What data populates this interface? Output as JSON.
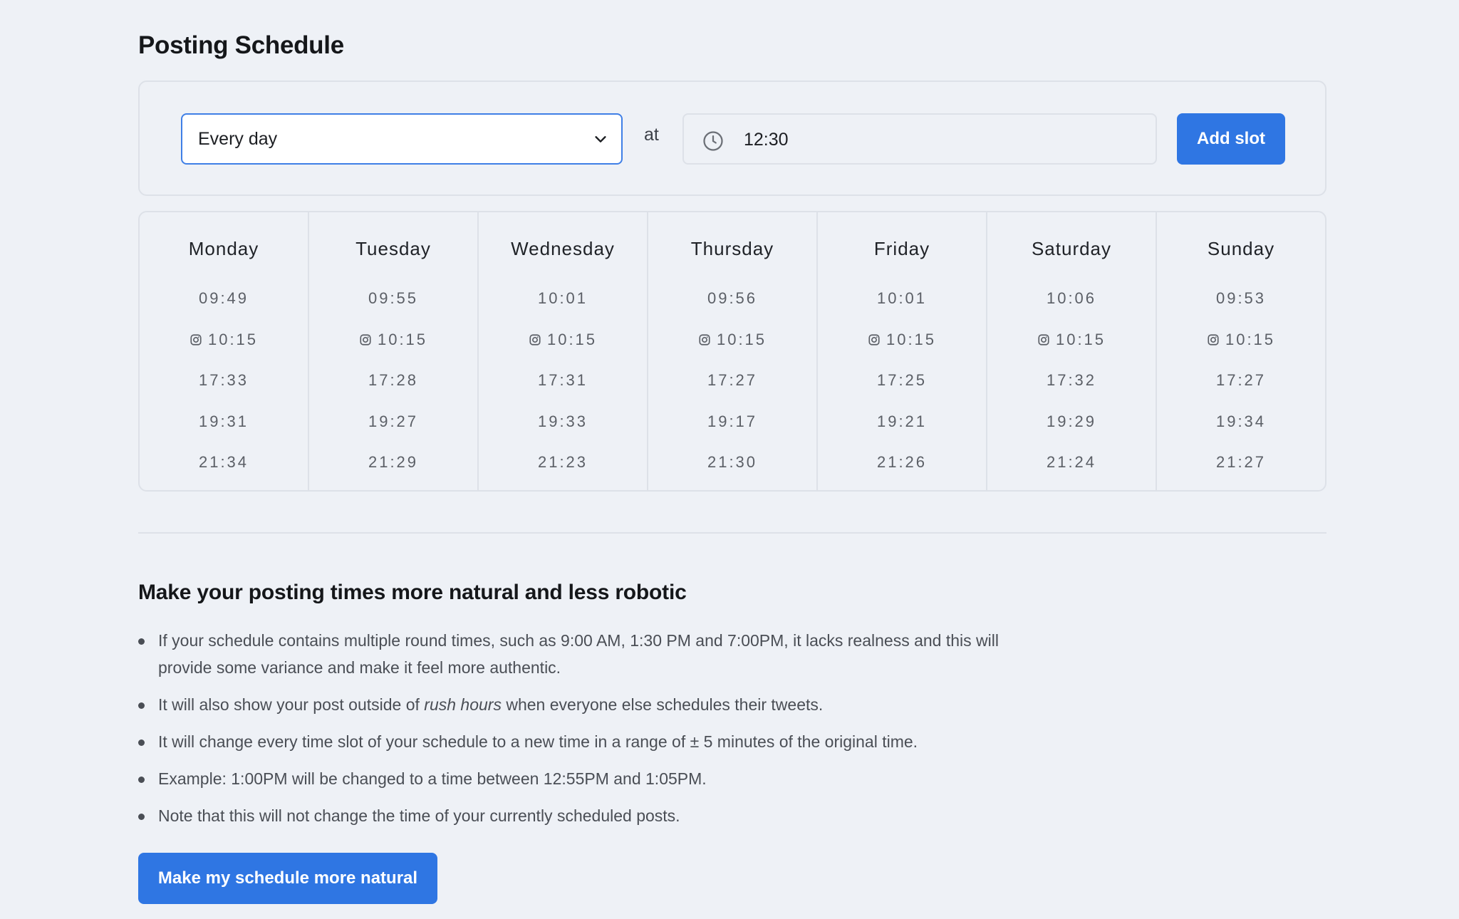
{
  "page": {
    "title": "Posting Schedule"
  },
  "slot_form": {
    "frequency_value": "Every day",
    "at_label": "at",
    "time_value": "12:30",
    "add_button_label": "Add slot"
  },
  "schedule": {
    "days": [
      {
        "name": "Monday",
        "slots": [
          {
            "time": "09:49",
            "icon": false
          },
          {
            "time": "10:15",
            "icon": true
          },
          {
            "time": "17:33",
            "icon": false
          },
          {
            "time": "19:31",
            "icon": false
          },
          {
            "time": "21:34",
            "icon": false
          }
        ]
      },
      {
        "name": "Tuesday",
        "slots": [
          {
            "time": "09:55",
            "icon": false
          },
          {
            "time": "10:15",
            "icon": true
          },
          {
            "time": "17:28",
            "icon": false
          },
          {
            "time": "19:27",
            "icon": false
          },
          {
            "time": "21:29",
            "icon": false
          }
        ]
      },
      {
        "name": "Wednesday",
        "slots": [
          {
            "time": "10:01",
            "icon": false
          },
          {
            "time": "10:15",
            "icon": true
          },
          {
            "time": "17:31",
            "icon": false
          },
          {
            "time": "19:33",
            "icon": false
          },
          {
            "time": "21:23",
            "icon": false
          }
        ]
      },
      {
        "name": "Thursday",
        "slots": [
          {
            "time": "09:56",
            "icon": false
          },
          {
            "time": "10:15",
            "icon": true
          },
          {
            "time": "17:27",
            "icon": false
          },
          {
            "time": "19:17",
            "icon": false
          },
          {
            "time": "21:30",
            "icon": false
          }
        ]
      },
      {
        "name": "Friday",
        "slots": [
          {
            "time": "10:01",
            "icon": false
          },
          {
            "time": "10:15",
            "icon": true
          },
          {
            "time": "17:25",
            "icon": false
          },
          {
            "time": "19:21",
            "icon": false
          },
          {
            "time": "21:26",
            "icon": false
          }
        ]
      },
      {
        "name": "Saturday",
        "slots": [
          {
            "time": "10:06",
            "icon": false
          },
          {
            "time": "10:15",
            "icon": true
          },
          {
            "time": "17:32",
            "icon": false
          },
          {
            "time": "19:29",
            "icon": false
          },
          {
            "time": "21:24",
            "icon": false
          }
        ]
      },
      {
        "name": "Sunday",
        "slots": [
          {
            "time": "09:53",
            "icon": false
          },
          {
            "time": "10:15",
            "icon": true
          },
          {
            "time": "17:27",
            "icon": false
          },
          {
            "time": "19:34",
            "icon": false
          },
          {
            "time": "21:27",
            "icon": false
          }
        ]
      }
    ],
    "slot_icon": "instagram-icon"
  },
  "natural": {
    "title": "Make your posting times more natural and less robotic",
    "tips": [
      {
        "before": "If your schedule contains multiple round times, such as 9:00 AM, 1:30 PM and 7:00PM, it lacks realness and this will provide some variance and make it feel more authentic.",
        "em": "",
        "after": ""
      },
      {
        "before": "It will also show your post outside of ",
        "em": "rush hours",
        "after": " when everyone else schedules their tweets."
      },
      {
        "before": "It will change every time slot of your schedule to a new time in a range of ± 5 minutes of the original time.",
        "em": "",
        "after": ""
      },
      {
        "before": "Example: 1:00PM will be changed to a time between 12:55PM and 1:05PM.",
        "em": "",
        "after": ""
      },
      {
        "before": "Note that this will not change the time of your currently scheduled posts.",
        "em": "",
        "after": ""
      }
    ],
    "button_label": "Make my schedule more natural"
  },
  "colors": {
    "background": "#eef1f6",
    "accent": "#2f76e3",
    "border": "#dde1e8",
    "select_border": "#3f7fe6"
  }
}
